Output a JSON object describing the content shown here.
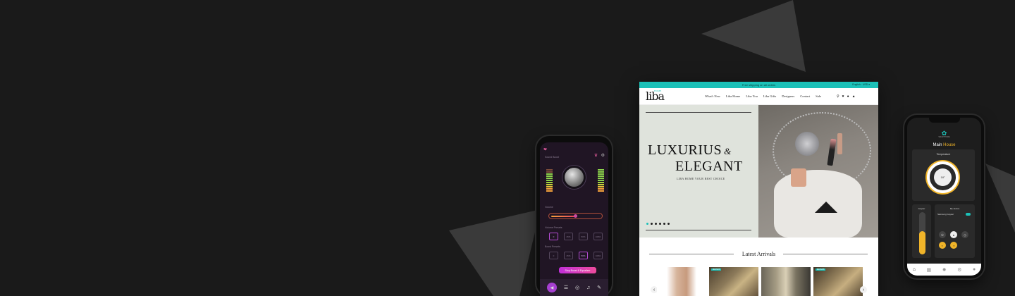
{
  "audio_app": {
    "section_boost": "Sound Boost",
    "section_volume": "Volume",
    "section_presets": "Volume Presets",
    "section_bass": "Boost Presets",
    "volume_presets": [
      "0",
      "25%",
      "50%",
      "100%"
    ],
    "bass_presets": [
      "0",
      "25%",
      "50%",
      "100%"
    ],
    "cta_label": "Stop Boost & Equalizer",
    "nav_icons": [
      "speaker-icon",
      "equalizer-icon",
      "spatial-icon",
      "music-note-icon",
      "broom-icon"
    ],
    "volume_level": 0.5
  },
  "website": {
    "promo_text": "Free shipping on all orders",
    "language": "English · USD ▾",
    "logo": "liba",
    "logo_tag": "HOME",
    "menu": [
      "What's New",
      "Liba Home",
      "Liba You",
      "Liba Gifts",
      "Designers",
      "Contact",
      "Sale"
    ],
    "hero": {
      "line1": "LUXURIUS",
      "amp": "&",
      "line2": "ELEGANT",
      "subtitle": "LIBA HOME YOUR BEST CHOICE",
      "slide_count": 6,
      "active_slide": 0
    },
    "arrivals_title": "Latest Arrivals",
    "card_tags": [
      "",
      "BRANDS",
      "",
      "BRANDS"
    ],
    "accent": "#1cc1b8"
  },
  "smart_home": {
    "logo": "SMARTHOME",
    "title_main": "Main",
    "title_accent": "House",
    "temperature_label": "Temperature",
    "temperature_value": "18°",
    "geyser_label": "Geyser",
    "devices_label": "My device",
    "device_name": "Samsung Geyser",
    "geyser_level": 0.55,
    "nav_icons": [
      "home-icon",
      "calendar-icon",
      "bulb-icon",
      "gear-icon",
      "user-icon"
    ]
  }
}
